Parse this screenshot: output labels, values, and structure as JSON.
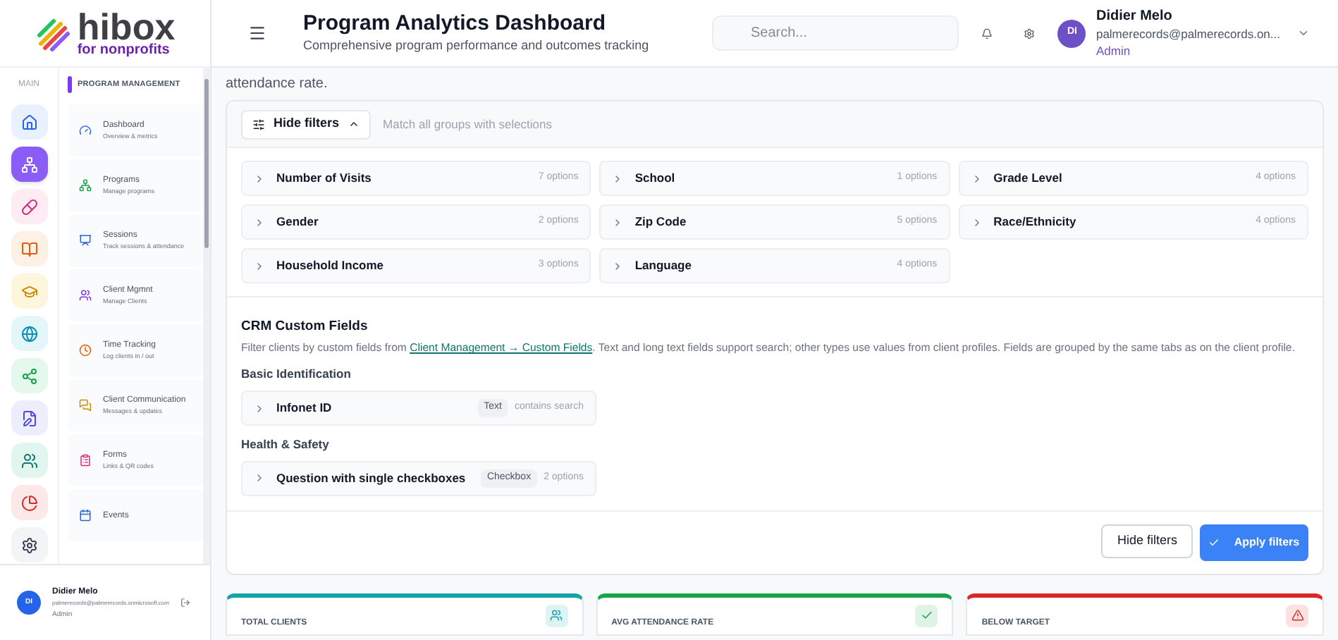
{
  "logo": {
    "name": "hibox",
    "tagline": "for nonprofits"
  },
  "header": {
    "title": "Program Analytics Dashboard",
    "subtitle": "Comprehensive program performance and outcomes tracking",
    "search": {
      "placeholder": "Search..."
    },
    "user": {
      "initials": "DI",
      "name": "Didier Melo",
      "email": "palmerecords@palmerecords.on...",
      "role": "Admin"
    }
  },
  "rail": {
    "label": "MAIN",
    "items": [
      {
        "kind": "home",
        "selected": false
      },
      {
        "kind": "programs",
        "selected": true
      },
      {
        "kind": "pills",
        "selected": false
      },
      {
        "kind": "book",
        "selected": false
      },
      {
        "kind": "cap",
        "selected": false
      },
      {
        "kind": "globe",
        "selected": false
      },
      {
        "kind": "share",
        "selected": false
      },
      {
        "kind": "edit",
        "selected": false
      },
      {
        "kind": "users",
        "selected": false
      },
      {
        "kind": "pie",
        "selected": false
      },
      {
        "kind": "settings",
        "selected": false
      }
    ]
  },
  "nav": {
    "section": "PROGRAM MANAGEMENT",
    "items": [
      {
        "kind": "dashboard",
        "title": "Dashboard",
        "desc": "Overview & metrics"
      },
      {
        "kind": "programs",
        "title": "Programs",
        "desc": "Manage programs"
      },
      {
        "kind": "sessions",
        "title": "Sessions",
        "desc": "Track sessions & attendance"
      },
      {
        "kind": "clients",
        "title": "Client Mgmnt",
        "desc": "Manage Clients"
      },
      {
        "kind": "time",
        "title": "Time Tracking",
        "desc": "Log clients in / out"
      },
      {
        "kind": "chat",
        "title": "Client Communication",
        "desc": "Messages & updates"
      },
      {
        "kind": "forms",
        "title": "Forms",
        "desc": "Links & QR codes"
      },
      {
        "kind": "events",
        "title": "Events"
      }
    ]
  },
  "sidebar_user": {
    "initials": "DI",
    "name": "Didier Melo",
    "email": "palmerecords@palmerecords.onmicrosoft.com",
    "role": "Admin"
  },
  "intro_tail": "attendance rate.",
  "filters": {
    "toggle": "Hide filters",
    "match_hint": "Match all groups with selections",
    "groups": [
      {
        "label": "Number of Visits",
        "count": "7 options"
      },
      {
        "label": "School",
        "count": "1 options"
      },
      {
        "label": "Grade Level",
        "count": "4 options"
      },
      {
        "label": "Gender",
        "count": "2 options"
      },
      {
        "label": "Zip Code",
        "count": "5 options"
      },
      {
        "label": "Race/Ethnicity",
        "count": "4 options"
      },
      {
        "label": "Household Income",
        "count": "3 options"
      },
      {
        "label": "Language",
        "count": "4 options"
      }
    ],
    "crm": {
      "title": "CRM Custom Fields",
      "desc_before": "Filter clients by custom fields from",
      "link": "Client Management → Custom Fields",
      "desc_after": ". Text and long text fields support search; other types use values from client profiles. Fields are grouped by the same tabs as on the client profile.",
      "sections": [
        {
          "title": "Basic Identification",
          "fields": [
            {
              "label": "Infonet ID",
              "type": "Text",
              "hint": "contains search"
            }
          ]
        },
        {
          "title": "Health & Safety",
          "fields": [
            {
              "label": "Question with single checkboxes",
              "type": "Checkbox",
              "hint": "2 options"
            }
          ]
        }
      ]
    },
    "buttons": {
      "hide": "Hide filters",
      "apply": "Apply filters"
    }
  },
  "stats": [
    {
      "label": "TOTAL CLIENTS",
      "color": "#14a3a8",
      "kind": "users"
    },
    {
      "label": "AVG ATTENDANCE RATE",
      "color": "#16a34a",
      "kind": "check"
    },
    {
      "label": "BELOW TARGET",
      "color": "#dc2626",
      "kind": "alert"
    }
  ]
}
